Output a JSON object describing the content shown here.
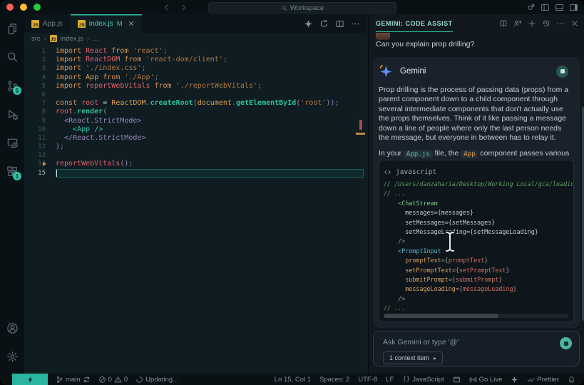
{
  "window": {
    "command_center": "Workspace",
    "titlebar_right_icons": [
      "account-status",
      "layout-sidebar-left",
      "layout-panel",
      "layout-sidebar-right"
    ]
  },
  "activity_bar": {
    "top": [
      {
        "name": "explorer"
      },
      {
        "name": "search"
      },
      {
        "name": "source-control",
        "badge": "5"
      },
      {
        "name": "run-debug"
      },
      {
        "name": "remote-explorer"
      },
      {
        "name": "extensions",
        "badge": "1"
      }
    ],
    "bottom": [
      {
        "name": "account"
      },
      {
        "name": "settings"
      }
    ]
  },
  "tabs": [
    {
      "label": "App.js",
      "active": false
    },
    {
      "label": "index.js",
      "git_status": "M",
      "active": true,
      "closable": true
    }
  ],
  "editor_actions": [
    "sparkle",
    "loop",
    "split",
    "ellipsis"
  ],
  "breadcrumb": {
    "items": [
      "src",
      "index.js",
      "..."
    ]
  },
  "editor": {
    "cursor": {
      "line": 15,
      "col": 1
    },
    "lines": [
      {
        "n": 1,
        "t": [
          [
            "k",
            "import"
          ],
          [
            "w",
            " "
          ],
          [
            "p",
            "React"
          ],
          [
            "k",
            " from"
          ],
          [
            "w",
            " "
          ],
          [
            "s",
            "'react'"
          ],
          [
            "g",
            ";"
          ]
        ]
      },
      {
        "n": 2,
        "t": [
          [
            "k",
            "import"
          ],
          [
            "w",
            " "
          ],
          [
            "p",
            "ReactDOM"
          ],
          [
            "k",
            " from"
          ],
          [
            "w",
            " "
          ],
          [
            "s",
            "'react-dom/client'"
          ],
          [
            "g",
            ";"
          ]
        ]
      },
      {
        "n": 3,
        "t": [
          [
            "k",
            "import"
          ],
          [
            "w",
            " "
          ],
          [
            "s",
            "'./index.css'"
          ],
          [
            "g",
            ";"
          ]
        ]
      },
      {
        "n": 4,
        "t": [
          [
            "k",
            "import"
          ],
          [
            "w",
            " "
          ],
          [
            "o",
            "App"
          ],
          [
            "k",
            " from"
          ],
          [
            "w",
            " "
          ],
          [
            "s",
            "'./App'"
          ],
          [
            "g",
            ";"
          ]
        ]
      },
      {
        "n": 5,
        "t": [
          [
            "k",
            "import"
          ],
          [
            "w",
            " "
          ],
          [
            "p",
            "reportWebVitals"
          ],
          [
            "k",
            " from"
          ],
          [
            "w",
            " "
          ],
          [
            "s",
            "'./reportWebVitals'"
          ],
          [
            "g",
            ";"
          ]
        ]
      },
      {
        "n": 6,
        "t": []
      },
      {
        "n": 7,
        "t": [
          [
            "k",
            "const"
          ],
          [
            "w",
            " "
          ],
          [
            "p",
            "root"
          ],
          [
            "w",
            " = "
          ],
          [
            "o",
            "ReactDOM"
          ],
          [
            "g",
            "."
          ],
          [
            "f",
            "createRoot"
          ],
          [
            "u",
            "("
          ],
          [
            "o",
            "document"
          ],
          [
            "g",
            "."
          ],
          [
            "f",
            "getElementById"
          ],
          [
            "u",
            "("
          ],
          [
            "s",
            "'root'"
          ],
          [
            "u",
            "))"
          ],
          [
            "g",
            ";"
          ]
        ]
      },
      {
        "n": 8,
        "t": [
          [
            "p",
            "root"
          ],
          [
            "g",
            "."
          ],
          [
            "f",
            "render"
          ],
          [
            "u",
            "("
          ]
        ]
      },
      {
        "n": 9,
        "t": [
          [
            "w",
            "  "
          ],
          [
            "j",
            "<React.StrictMode>"
          ]
        ]
      },
      {
        "n": 10,
        "t": [
          [
            "w",
            "    "
          ],
          [
            "c",
            "<App />"
          ]
        ]
      },
      {
        "n": 11,
        "t": [
          [
            "w",
            "  "
          ],
          [
            "j",
            "</React.StrictMode>"
          ]
        ]
      },
      {
        "n": 12,
        "t": [
          [
            "u",
            ")"
          ],
          [
            "g",
            ";"
          ]
        ]
      },
      {
        "n": 13,
        "t": []
      },
      {
        "n": 14,
        "t": [
          [
            "p",
            "reportWebVitals"
          ],
          [
            "u",
            "()"
          ],
          [
            "g",
            ";"
          ]
        ],
        "marker": true
      },
      {
        "n": 15,
        "t": [],
        "current": true
      }
    ]
  },
  "gemini_panel": {
    "title": "GEMINI: CODE ASSIST",
    "header_icons": [
      "book",
      "feedback",
      "plus",
      "history",
      "ellipsis",
      "close"
    ],
    "user_message": "Can you explain prop drilling?",
    "assistant_name": "Gemini",
    "response": {
      "paragraph1": "Prop drilling is the process of passing data (props) from a parent component down to a child component through several intermediate components that don't actually use the props themselves. Think of it like passing a message down a line of people where only the last person needs the message, but everyone in between has to relay it.",
      "paragraph2": [
        {
          "text": "In your "
        },
        {
          "code": "App.js",
          "style": "teal"
        },
        {
          "text": " file, the "
        },
        {
          "code": "App",
          "style": "orange"
        },
        {
          "text": " component passes various props to its direct children. For example:"
        }
      ],
      "code_block": {
        "language": "javascript",
        "lines": [
          [
            [
              "cm",
              "// /Users/danzaharia/Desktop/Working Local/gca/loading-"
            ]
          ],
          [
            [
              "cm",
              "// ..."
            ]
          ],
          [
            [
              "cg",
              "    <"
            ],
            [
              "tg",
              "ChatStream"
            ]
          ],
          [
            [
              "cw",
              "      messages={messages}"
            ]
          ],
          [
            [
              "cw",
              "      setMessages={setMessages}"
            ]
          ],
          [
            [
              "cw",
              "      setMessageLoading={setMessageLoading}"
            ]
          ],
          [
            [
              "cg",
              "    />"
            ]
          ],
          [
            [
              "cg",
              "    <"
            ],
            [
              "tb",
              "PromptInput"
            ]
          ],
          [
            [
              "ca",
              "      promptText"
            ],
            [
              "cg",
              "={"
            ],
            [
              "cv",
              "promptText"
            ],
            [
              "cg",
              "}"
            ]
          ],
          [
            [
              "ca",
              "      setPromptText"
            ],
            [
              "cg",
              "={"
            ],
            [
              "cv",
              "setPromptText"
            ],
            [
              "cg",
              "}"
            ]
          ],
          [
            [
              "ca",
              "      submitPrompt"
            ],
            [
              "cg",
              "={"
            ],
            [
              "cv",
              "submitPrompt"
            ],
            [
              "cg",
              "}"
            ]
          ],
          [
            [
              "ca",
              "      messageLoading"
            ],
            [
              "cg",
              "={"
            ],
            [
              "cv",
              "messageLoading"
            ],
            [
              "cg",
              "}"
            ]
          ],
          [
            [
              "cg",
              "    />"
            ]
          ],
          [
            [
              "cm",
              "// ..."
            ]
          ]
        ]
      }
    },
    "input": {
      "placeholder": "Ask Gemini or type '@'",
      "context_button": "1 context item"
    }
  },
  "status_bar": {
    "branch": "main",
    "errors": "0",
    "warnings": "0",
    "updating": "Updating...",
    "right": [
      {
        "label": "Ln 15, Col 1"
      },
      {
        "label": "Spaces: 2"
      },
      {
        "label": "UTF-8"
      },
      {
        "label": "LF"
      },
      {
        "icon": "braces",
        "label": "JavaScript"
      },
      {
        "icon": "browser",
        "label": ""
      },
      {
        "icon": "broadcast",
        "label": "Go Live"
      },
      {
        "icon": "sparkle",
        "label": ""
      },
      {
        "icon": "check2",
        "label": "Prettier"
      },
      {
        "icon": "bell",
        "label": ""
      }
    ]
  },
  "colors": {
    "accent_teal": "#2cc3a8",
    "gemini_blue": "#4e86f6",
    "badge_teal": "#2cc3a8",
    "js_badge": "#d9a831"
  }
}
